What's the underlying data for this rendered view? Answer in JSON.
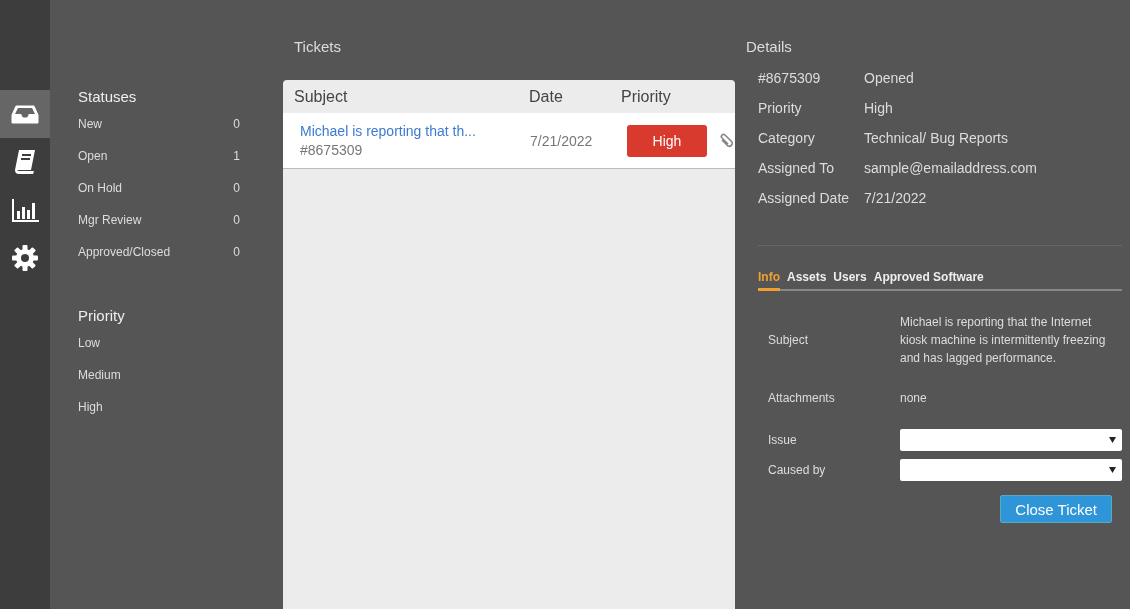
{
  "rail": [
    {
      "kind": "inbox",
      "selected": true
    },
    {
      "kind": "book",
      "selected": false
    },
    {
      "kind": "chart",
      "selected": false
    },
    {
      "kind": "settings",
      "selected": false
    }
  ],
  "filters": {
    "statuses_title": "Statuses",
    "statuses": [
      {
        "label": "New",
        "count": "0"
      },
      {
        "label": "Open",
        "count": "1"
      },
      {
        "label": "On Hold",
        "count": "0"
      },
      {
        "label": "Mgr Review",
        "count": "0"
      },
      {
        "label": "Approved/Closed",
        "count": "0"
      }
    ],
    "priority_title": "Priority",
    "priorities": [
      "Low",
      "Medium",
      "High"
    ]
  },
  "tickets": {
    "title": "Tickets",
    "columns": [
      "Subject",
      "Date",
      "Priority"
    ],
    "rows": [
      {
        "subject": "Michael is reporting that th...",
        "number": "#8675309",
        "date": "7/21/2022",
        "priority": "High",
        "attachment": true
      }
    ]
  },
  "details": {
    "title": "Details",
    "fields": [
      {
        "label": "#8675309",
        "value": "Opened"
      },
      {
        "label": "Priority",
        "value": "High"
      },
      {
        "label": "Category",
        "value": "Technical/ Bug Reports"
      },
      {
        "label": "Assigned To",
        "value": "sample@emailaddress.com"
      },
      {
        "label": "Assigned Date",
        "value": "7/21/2022"
      }
    ],
    "tabs": [
      {
        "label": "Info",
        "selected": true
      },
      {
        "label": "Assets",
        "selected": false
      },
      {
        "label": "Users",
        "selected": false
      },
      {
        "label": "Approved Software",
        "selected": false
      }
    ],
    "info": [
      {
        "kind": "text",
        "label": "Subject",
        "value": "Michael is reporting that the Internet kiosk machine is intermittently freezing and has lagged performance."
      },
      {
        "kind": "text",
        "label": "Attachments",
        "value": "none"
      },
      {
        "kind": "select",
        "label": "Issue"
      },
      {
        "kind": "select",
        "label": "Caused by"
      }
    ],
    "button": "Close Ticket"
  }
}
